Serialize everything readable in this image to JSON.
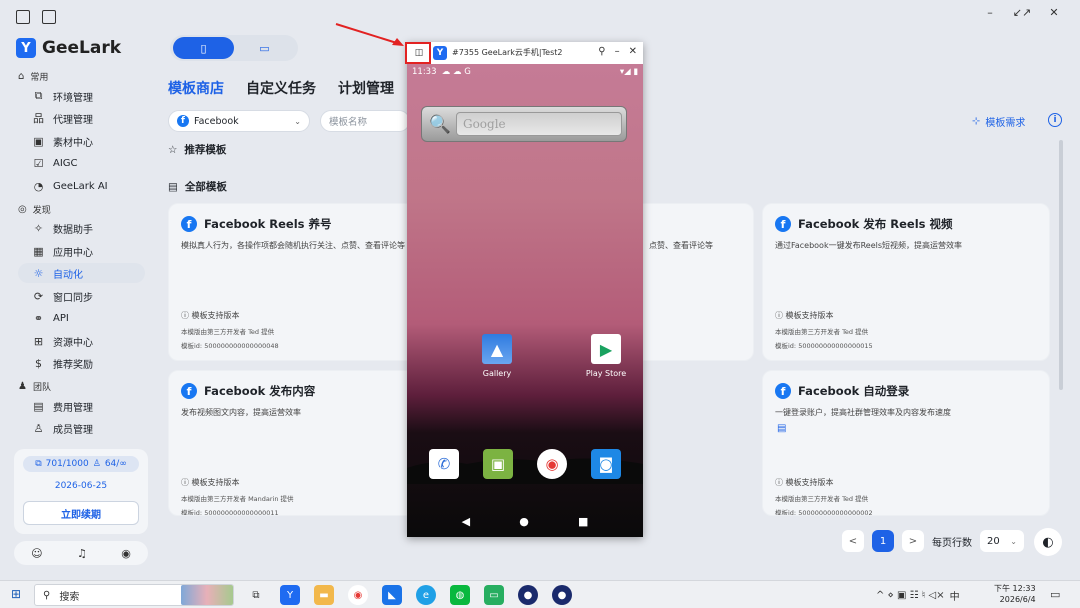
{
  "window": {
    "minimize": "–",
    "restore": "↙↗",
    "close": "✕"
  },
  "app": {
    "name": "GeeLark",
    "logo_glyph": "Y"
  },
  "sidebar": {
    "sections": [
      {
        "label": "常用"
      },
      {
        "label": "发现"
      },
      {
        "label": "团队"
      }
    ],
    "items": [
      {
        "label": "环境管理",
        "icon": "window-icon",
        "glyph": "⧉"
      },
      {
        "label": "代理管理",
        "icon": "proxy-icon",
        "glyph": "品"
      },
      {
        "label": "素材中心",
        "icon": "image-icon",
        "glyph": "▣"
      },
      {
        "label": "AIGC",
        "icon": "aigc-icon",
        "glyph": "☑"
      },
      {
        "label": "GeeLark AI",
        "icon": "ai-icon",
        "glyph": "◔"
      },
      {
        "label": "数据助手",
        "icon": "data-icon",
        "glyph": "✧"
      },
      {
        "label": "应用中心",
        "icon": "apps-icon",
        "glyph": "▦"
      },
      {
        "label": "自动化",
        "icon": "automation-icon",
        "glyph": "☼"
      },
      {
        "label": "窗口同步",
        "icon": "sync-icon",
        "glyph": "⟳"
      },
      {
        "label": "API",
        "icon": "api-icon",
        "glyph": "⚭"
      },
      {
        "label": "资源中心",
        "icon": "resource-icon",
        "glyph": "⊞"
      },
      {
        "label": "推荐奖励",
        "icon": "reward-icon",
        "glyph": "$"
      },
      {
        "label": "费用管理",
        "icon": "billing-icon",
        "glyph": "▤"
      },
      {
        "label": "成员管理",
        "icon": "member-icon",
        "glyph": "♙"
      }
    ],
    "plan": {
      "profiles": "701/1000",
      "members": "64/∞",
      "date": "2026-06-25",
      "renew": "立即续期"
    }
  },
  "main": {
    "tabs": [
      {
        "label": "模板商店"
      },
      {
        "label": "自定义任务"
      },
      {
        "label": "计划管理"
      }
    ],
    "platform": "Facebook",
    "search_placeholder": "模板名称",
    "recommended": "推荐模板",
    "all_templates": "全部模板",
    "demand": "模板需求",
    "cards": [
      {
        "title": "Facebook Reels 养号",
        "desc": "模拟真人行为，各操作项都会随机执行关注、点赞、查看评论等",
        "support": "模板支持版本",
        "author": "本模版由第三方开发者 Ted 提供",
        "id": "模板id: 500000000000000048"
      },
      {
        "title": "",
        "desc": "点赞、查看评论等",
        "support": "",
        "author": "",
        "id": ""
      },
      {
        "title": "Facebook 发布 Reels 视频",
        "desc": "通过Facebook一键发布Reels短视频，提高运营效率",
        "support": "模板支持版本",
        "author": "本模版由第三方开发者 Ted 提供",
        "id": "模板id: 500000000000000015"
      },
      {
        "title": "Facebook 发布内容",
        "desc": "发布视频图文内容，提高运营效率",
        "support": "模板支持版本",
        "author": "本模版由第三方开发者 Mandarin 提供",
        "id": "模板id: 500000000000000011"
      },
      {
        "title": "Facebook 自动登录",
        "desc": "一键登录账户，提高社群管理效率及内容发布速度",
        "support": "模板支持版本",
        "author": "本模版由第三方开发者 Ted 提供",
        "id": "模板id: 500000000000000002"
      }
    ],
    "pager": {
      "prev": "<",
      "page": "1",
      "next": ">",
      "rows_label": "每页行数",
      "rows": "20"
    }
  },
  "phone": {
    "title": "#7355 GeeLark云手机|Test2",
    "time": "11:33",
    "status_icons": "☁ ☁ G",
    "signal": "▾◢ ▮",
    "search_text": "Google",
    "apps": [
      {
        "label": "Gallery"
      },
      {
        "label": "Play Store"
      }
    ],
    "nav": [
      "◀",
      "●",
      "■"
    ]
  },
  "taskbar": {
    "search": "搜索",
    "time": "下午 12:33",
    "date": "2026/6/4",
    "ime": "中",
    "tray": "^ ⋄ ▣ ☷ ♮ ◁×"
  }
}
